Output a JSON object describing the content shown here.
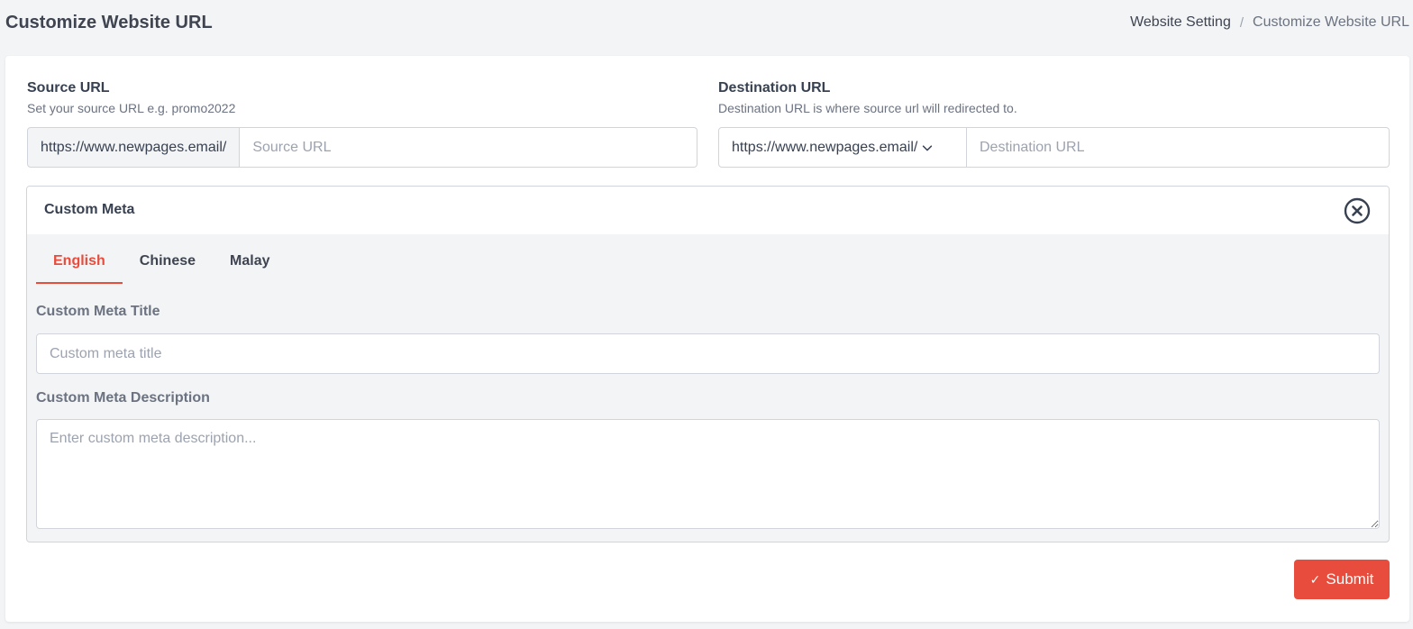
{
  "header": {
    "title": "Customize Website URL",
    "breadcrumb": [
      {
        "label": "Website Setting"
      },
      {
        "label": "Customize Website URL"
      }
    ],
    "breadcrumb_separator": "/"
  },
  "source": {
    "label": "Source URL",
    "help": "Set your source URL e.g. promo2022",
    "prefix": "https://www.newpages.email/",
    "value": "",
    "placeholder": "Source URL"
  },
  "destination": {
    "label": "Destination URL",
    "help": "Destination URL is where source url will redirected to.",
    "prefix_selected": "https://www.newpages.email/",
    "value": "",
    "placeholder": "Destination URL"
  },
  "custom_meta": {
    "title": "Custom Meta",
    "close_icon": "circle-x-icon",
    "tabs": [
      {
        "label": "English",
        "active": true
      },
      {
        "label": "Chinese",
        "active": false
      },
      {
        "label": "Malay",
        "active": false
      }
    ],
    "meta_title_label": "Custom Meta Title",
    "meta_title_placeholder": "Custom meta title",
    "meta_title_value": "",
    "meta_description_label": "Custom Meta Description",
    "meta_description_placeholder": "Enter custom meta description...",
    "meta_description_value": ""
  },
  "actions": {
    "submit_label": "Submit",
    "submit_icon": "check-icon",
    "submit_glyph": "✓"
  },
  "colors": {
    "accent": "#e74c3c",
    "background": "#f3f4f6",
    "card": "#ffffff",
    "border": "#d1d5db"
  }
}
